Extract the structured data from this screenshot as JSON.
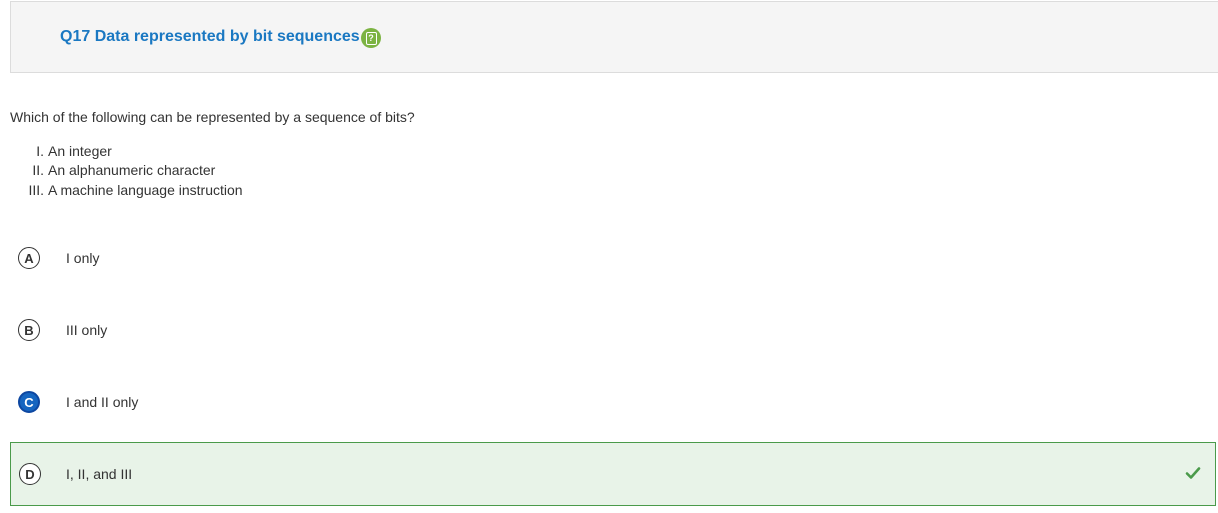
{
  "header": {
    "title": "Q17 Data represented by bit sequences",
    "help_icon": "help-badge-icon",
    "help_glyph": "?"
  },
  "question": {
    "prompt": "Which of the following can be represented by a sequence of bits?",
    "statements": [
      {
        "num": "I.",
        "text": "An integer"
      },
      {
        "num": "II.",
        "text": "An alphanumeric character"
      },
      {
        "num": "III.",
        "text": "A machine language instruction"
      }
    ]
  },
  "choices": [
    {
      "letter": "A",
      "text": "I only",
      "selected": false,
      "correct": false
    },
    {
      "letter": "B",
      "text": "III only",
      "selected": false,
      "correct": false
    },
    {
      "letter": "C",
      "text": "I and II only",
      "selected": true,
      "correct": false
    },
    {
      "letter": "D",
      "text": "I, II, and III",
      "selected": false,
      "correct": true
    }
  ],
  "colors": {
    "title": "#1a78c2",
    "help_badge": "#7cb342",
    "selected": "#1565c0",
    "correct_bg": "#e8f3e8",
    "correct_border": "#4a9a4a",
    "check": "#4a9a4a"
  },
  "icons": {
    "correct_marker": "checkmark-icon"
  }
}
